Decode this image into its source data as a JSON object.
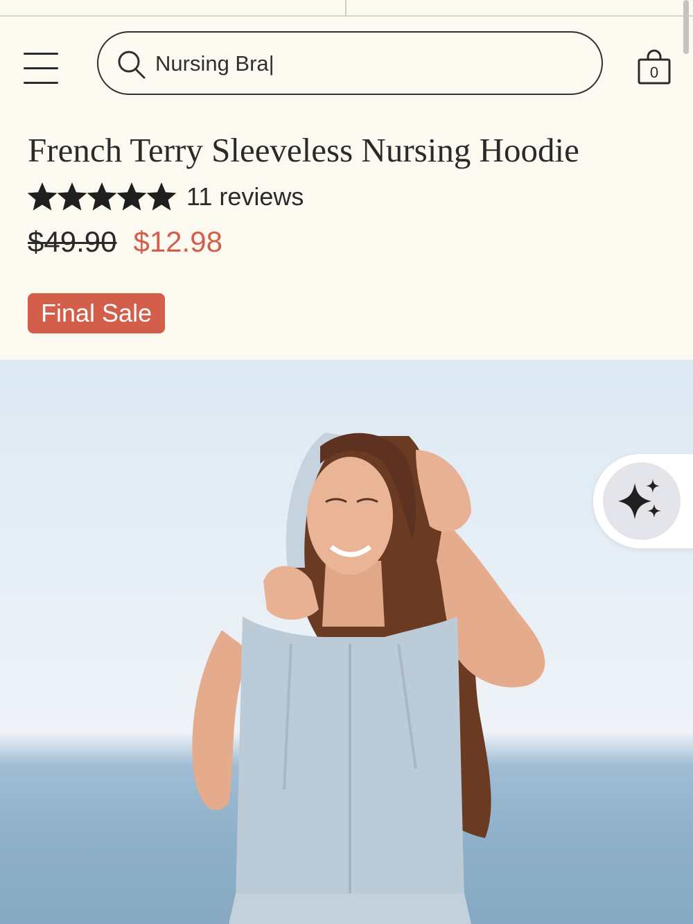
{
  "header": {
    "search": {
      "value": "Nursing Bra|",
      "placeholder": "Search"
    },
    "cart": {
      "count": "0"
    },
    "icons": {
      "menu": "hamburger-menu-icon",
      "search": "search-icon",
      "cart": "shopping-bag-icon"
    }
  },
  "product": {
    "title": "French Terry Sleeveless Nursing Hoodie",
    "rating": 5,
    "rating_max": 5,
    "reviews_label": "11 reviews",
    "original_price": "$49.90",
    "sale_price": "$12.98",
    "badge": "Final Sale"
  },
  "hero": {
    "image": "woman-in-sleeveless-hoodie-by-sea"
  },
  "ai_button": {
    "icon": "sparkles-icon"
  },
  "colors": {
    "background": "#fcf9f1",
    "sale": "#d25f4a",
    "badge": "#d35f4b",
    "text": "#2a2a2a"
  }
}
